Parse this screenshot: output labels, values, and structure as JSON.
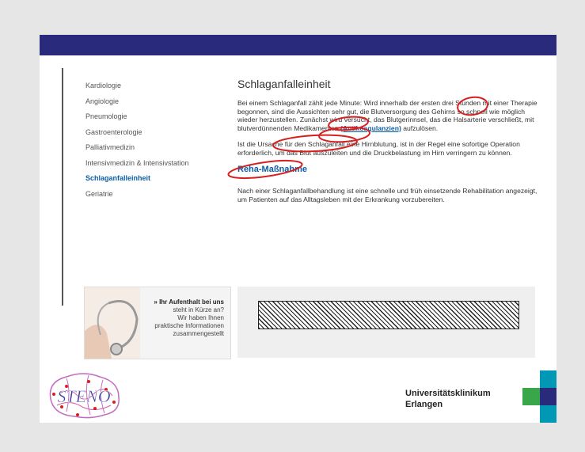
{
  "nav": {
    "items": [
      {
        "label": "Kardiologie"
      },
      {
        "label": "Angiologie"
      },
      {
        "label": "Pneumologie"
      },
      {
        "label": "Gastroenterologie"
      },
      {
        "label": "Palliativmedizin"
      },
      {
        "label": "Intensivmedizin & Intensivstation"
      },
      {
        "label": "Schlaganfalleinheit",
        "active": true
      },
      {
        "label": "Geriatrie"
      }
    ]
  },
  "main": {
    "title": "Schlaganfalleinheit",
    "p1_a": "Bei einem Schlaganfall zählt jede Minute: Wird innerhalb der ersten drei Stunden mit einer Therapie begonnen, sind die Aussichten sehr gut, die Blutversorgung des Gehirns so schnell wie möglich wieder herzustellen. Zunächst wird versucht, das Blutgerinnsel, das die Halsarterie verschließt, mit blutverdünnenden Medikamenten ",
    "p1_link": "(Antikoagulanzien)",
    "p1_b": " aufzulösen.",
    "p2": "Ist die Ursache für den Schlaganfall eine Hirnblutung, ist in der Regel eine sofortige Operation erforderlich, um das Blut auszuleiten und die Druckbelastung im Hirn verringern zu können.",
    "subheading": "Reha-Maßnahme",
    "p3": "Nach einer Schlaganfallbehandlung ist eine schnelle und früh einsetzende Rehabilitation angezeigt, um Patienten auf das Alltagsleben mit der Erkrankung vorzubereiten."
  },
  "promo": {
    "headline": "» Ihr Aufenthalt bei uns",
    "line1": "steht in Kürze an?",
    "line2": "Wir haben Ihnen",
    "line3": "praktische Informationen",
    "line4": "zusammengestellt"
  },
  "logo": {
    "text": "STENO"
  },
  "footer": {
    "university_line1": "Universitätsklinikum",
    "university_line2": "Erlangen"
  },
  "colors": {
    "topbar": "#2a2a7c",
    "link": "#0a5ea8",
    "annotation": "#d62020",
    "uni_green": "#3aa64a",
    "uni_teal": "#0098b5",
    "uni_navy": "#2a2a7c"
  }
}
